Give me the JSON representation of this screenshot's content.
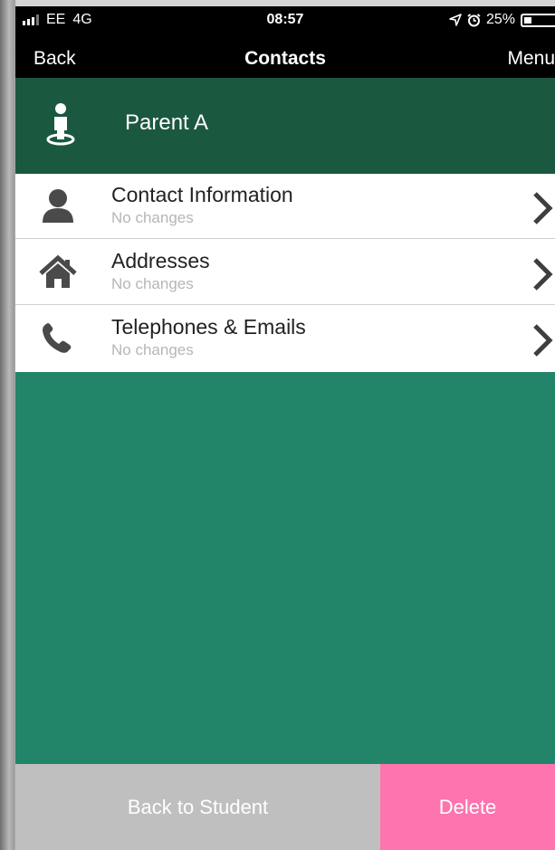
{
  "status_bar": {
    "carrier": "EE",
    "network": "4G",
    "time": "08:57",
    "battery_text": "25%",
    "battery_level": 0.25
  },
  "nav": {
    "back_label": "Back",
    "title": "Contacts",
    "menu_label": "Menu"
  },
  "header": {
    "name": "Parent A",
    "icon": "person-pin-icon"
  },
  "menu": {
    "items": [
      {
        "title": "Contact Information",
        "subtitle": "No changes",
        "icon": "user-icon"
      },
      {
        "title": "Addresses",
        "subtitle": "No changes",
        "icon": "home-icon"
      },
      {
        "title": "Telephones & Emails",
        "subtitle": "No changes",
        "icon": "phone-icon"
      }
    ]
  },
  "footer": {
    "back_to_student_label": "Back to Student",
    "delete_label": "Delete"
  },
  "colors": {
    "header_bg": "#1b5840",
    "content_bg": "#228469",
    "delete_bg": "#fd74ae",
    "secondary_button_bg": "#bfbfc0"
  }
}
